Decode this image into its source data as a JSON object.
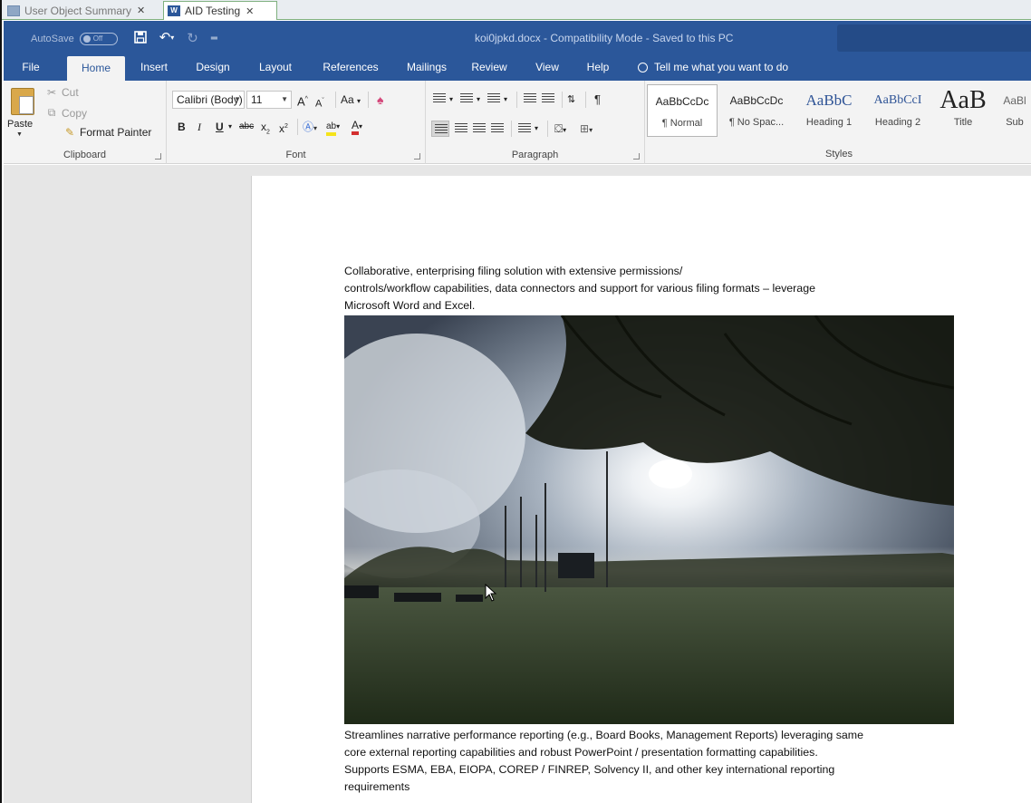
{
  "browser_tabs": [
    {
      "label": "User Object Summary",
      "active": false
    },
    {
      "label": "AID Testing",
      "active": true
    }
  ],
  "titlebar": {
    "autosave_label": "AutoSave",
    "autosave_state": "Off",
    "doc_title": "koi0jpkd.docx  -  Compatibility Mode  -  Saved to this PC"
  },
  "menu": {
    "tabs": [
      "File",
      "Home",
      "Insert",
      "Design",
      "Layout",
      "References",
      "Mailings",
      "Review",
      "View",
      "Help"
    ],
    "active": "Home",
    "tell_me": "Tell me what you want to do"
  },
  "ribbon": {
    "clipboard": {
      "paste": "Paste",
      "cut": "Cut",
      "copy": "Copy",
      "format_painter": "Format Painter",
      "label": "Clipboard"
    },
    "font": {
      "font_name": "Calibri (Body)",
      "font_size": "11",
      "grow": "A",
      "shrink": "A",
      "change_case": "Aa",
      "bold": "B",
      "italic": "I",
      "underline": "U",
      "strike": "abc",
      "subscript": "x",
      "superscript": "x",
      "label": "Font"
    },
    "paragraph": {
      "label": "Paragraph"
    },
    "styles": {
      "label": "Styles",
      "items": [
        {
          "sample": "AaBbCcDc",
          "name": "¶ Normal"
        },
        {
          "sample": "AaBbCcDc",
          "name": "¶ No Spac..."
        },
        {
          "sample": "AaBbC",
          "name": "Heading 1"
        },
        {
          "sample": "AaBbCcI",
          "name": "Heading 2"
        },
        {
          "sample": "AaB",
          "name": "Title"
        },
        {
          "sample": "AaBl",
          "name": "Sub"
        }
      ]
    }
  },
  "document": {
    "para1_line1": "Collaborative, enterprising filing solution with extensive permissions/",
    "para1_line2": "controls/workflow capabilities, data connectors and support for various filing formats – leverage",
    "para1_line3": "Microsoft Word and Excel.",
    "para2_line1": "Streamlines narrative performance reporting (e.g., Board Books, Management Reports) leveraging same",
    "para2_line2": "core external reporting capabilities and robust PowerPoint / presentation formatting capabilities.",
    "para2_line3": "Supports ESMA, EBA, EIOPA, COREP / FINREP, Solvency II, and other key international reporting",
    "para2_line4": "requirements"
  },
  "colors": {
    "word_blue": "#2b579a",
    "ribbon_bg": "#f3f3f3",
    "canvas_bg": "#e6e6e6"
  }
}
